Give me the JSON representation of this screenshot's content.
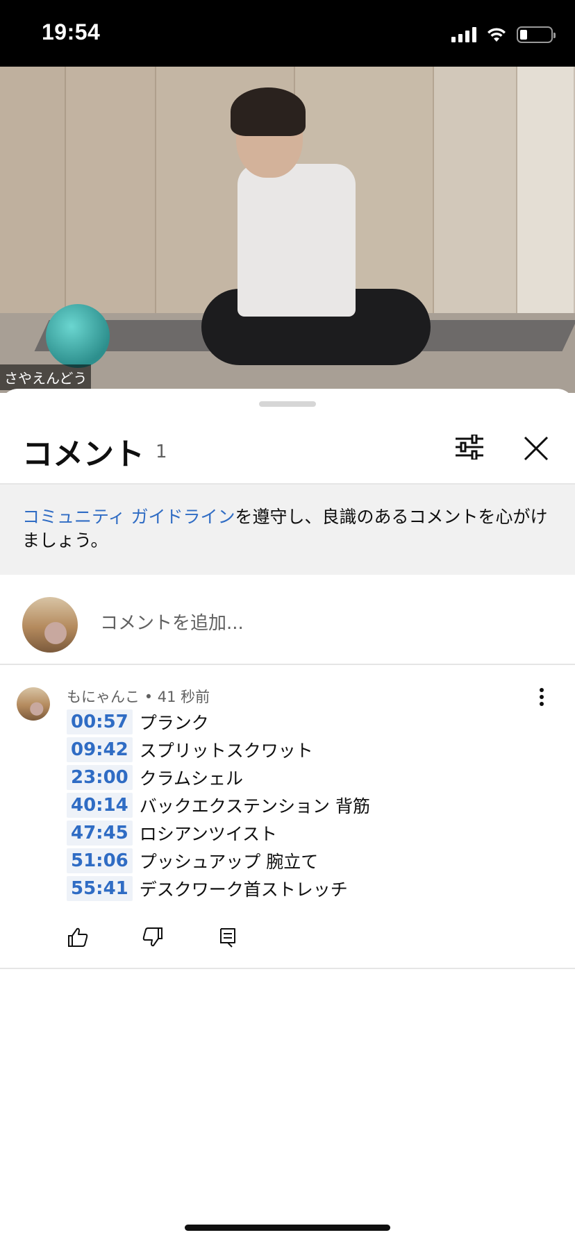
{
  "status_bar": {
    "time": "19:54"
  },
  "video": {
    "channel_label": "さやえんどう"
  },
  "comments_sheet": {
    "title": "コメント",
    "count": "1",
    "guidelines": {
      "link_text": "コミュニティ ガイドライン",
      "rest_text": "を遵守し、良識のあるコメントを心がけましょう。"
    },
    "add_comment_placeholder": "コメントを追加..."
  },
  "comment": {
    "author": "もにゃんこ",
    "time_ago": "41 秒前",
    "lines": [
      {
        "timestamp": "00:57",
        "text": "プランク"
      },
      {
        "timestamp": "09:42",
        "text": "スプリットスクワット"
      },
      {
        "timestamp": "23:00",
        "text": "クラムシェル"
      },
      {
        "timestamp": "40:14",
        "text": " バックエクステンション 背筋"
      },
      {
        "timestamp": "47:45",
        "text": " ロシアンツイスト"
      },
      {
        "timestamp": "51:06",
        "text": " プッシュアップ 腕立て"
      },
      {
        "timestamp": "55:41",
        "text": "デスクワーク首ストレッチ"
      }
    ]
  },
  "colors": {
    "link": "#2f6cc4",
    "timestamp_bg": "#eef2f8",
    "guidelines_bg": "#f1f1f1"
  },
  "icons": [
    "cellular-signal-icon",
    "wifi-icon",
    "battery-icon",
    "filter-icon",
    "close-icon",
    "more-vert-icon",
    "thumb-up-icon",
    "thumb-down-icon",
    "reply-icon"
  ]
}
